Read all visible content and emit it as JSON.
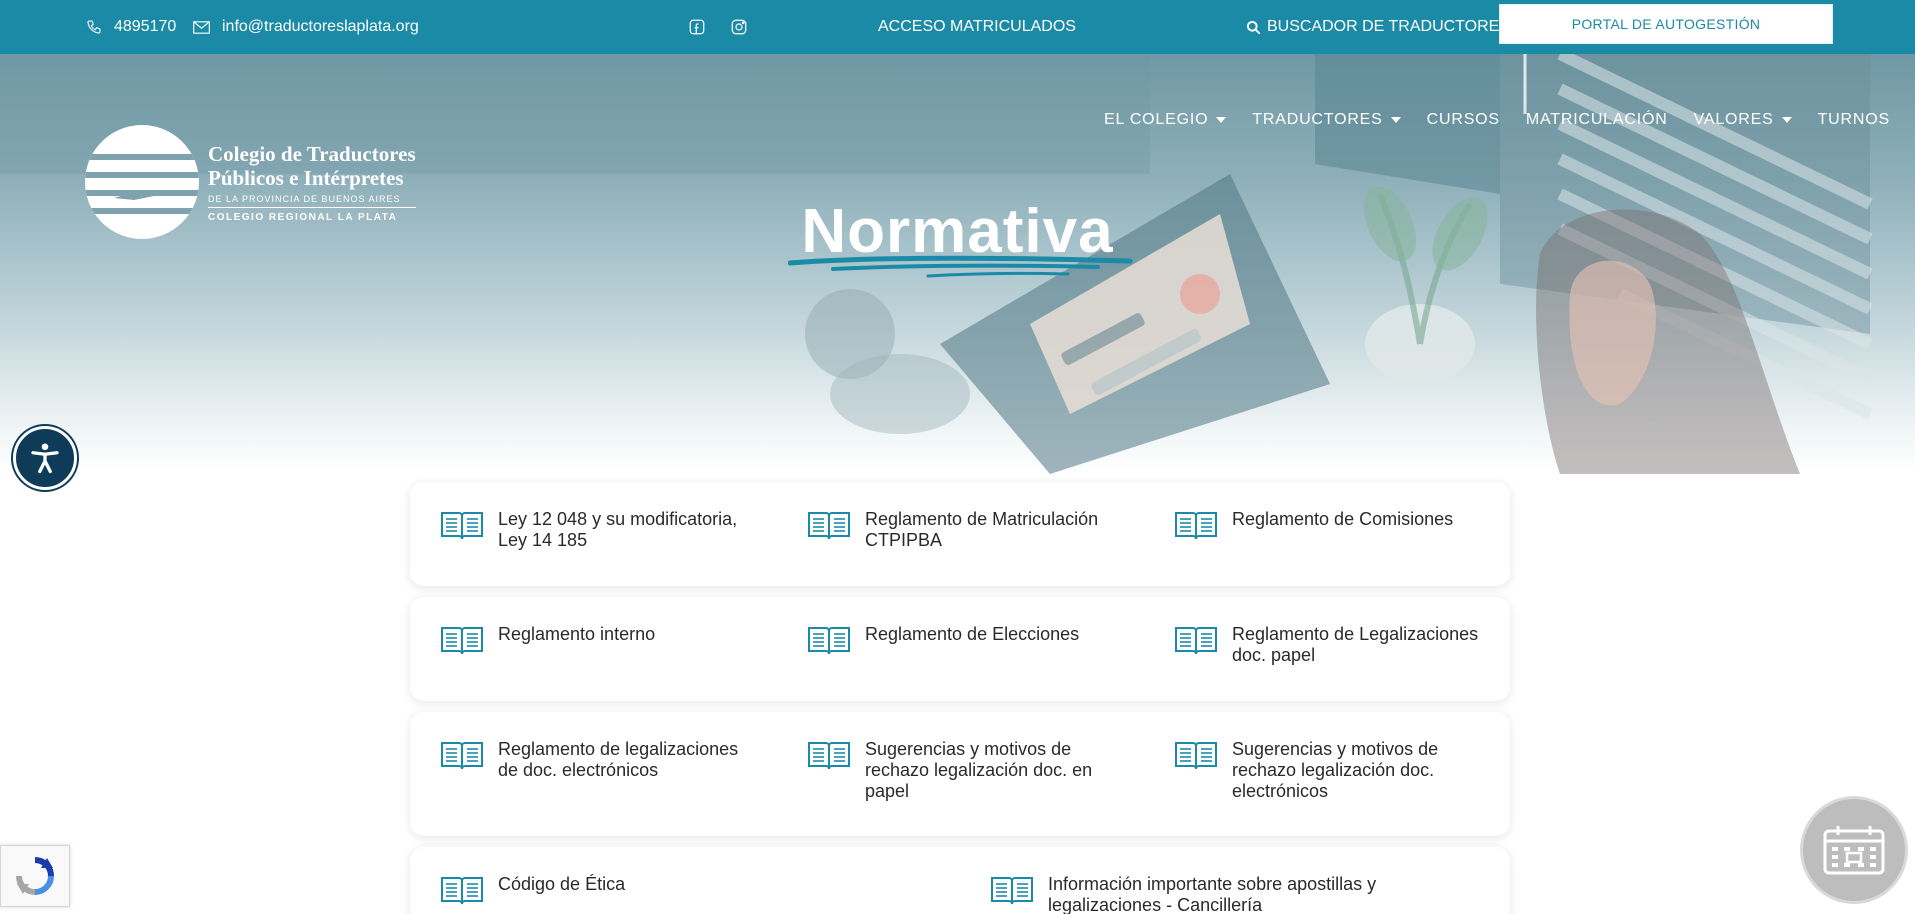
{
  "topbar": {
    "phone": "4895170",
    "email": "info@traductoreslaplata.org",
    "access_label": "ACCESO MATRICULADOS",
    "search_label": "BUSCADOR DE TRADUCTORES",
    "portal_label": "PORTAL DE AUTOGESTIÓN"
  },
  "logo": {
    "line1": "Colegio de Traductores",
    "line2": "Públicos e Intérpretes",
    "line3": "DE LA PROVINCIA DE BUENOS AIRES",
    "line4": "COLEGIO REGIONAL LA PLATA"
  },
  "nav": {
    "items": [
      {
        "label": "EL COLEGIO"
      },
      {
        "label": "TRADUCTORES"
      },
      {
        "label": "CURSOS"
      },
      {
        "label": "MATRICULACIÓN"
      },
      {
        "label": "VALORES"
      },
      {
        "label": "TURNOS"
      }
    ]
  },
  "hero": {
    "title": "Normativa"
  },
  "docs": {
    "row1": [
      {
        "label": "Ley 12 048 y su modificatoria, Ley 14 185"
      },
      {
        "label": "Reglamento de Matriculación CTPIPBA"
      },
      {
        "label": "Reglamento de Comisiones"
      }
    ],
    "row2": [
      {
        "label": "Reglamento interno"
      },
      {
        "label": "Reglamento de Elecciones"
      },
      {
        "label": "Reglamento de Legalizaciones doc. papel"
      }
    ],
    "row3": [
      {
        "label": "Reglamento de legalizaciones de doc. electrónicos"
      },
      {
        "label": "Sugerencias y motivos de rechazo legalización doc. en papel"
      },
      {
        "label": "Sugerencias y motivos de rechazo legalización doc. electrónicos"
      }
    ],
    "row4": [
      {
        "label": "Código de Ética"
      },
      {
        "label": "Información importante sobre apostillas y legalizaciones - Cancillería"
      }
    ]
  },
  "colors": {
    "primary": "#1b8aa6",
    "accessibility": "#0d3b58"
  }
}
